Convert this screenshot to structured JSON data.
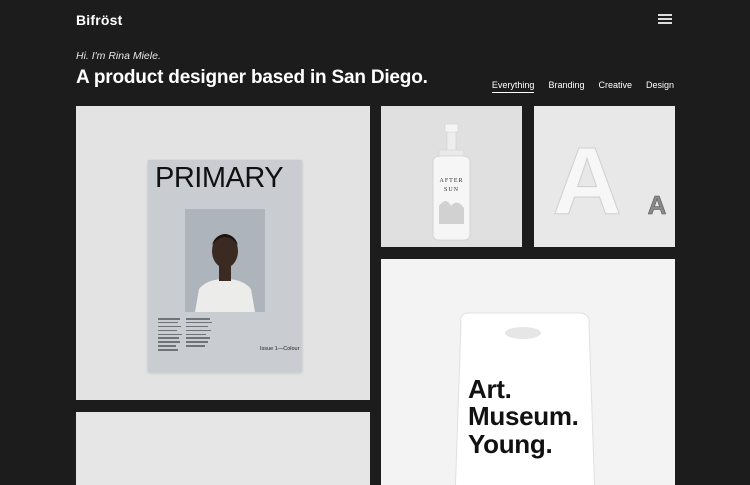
{
  "header": {
    "brand": "Bifröst",
    "menu_icon": "hamburger-icon"
  },
  "hero": {
    "intro": "Hi. I'm Rina Miele.",
    "headline": "A product designer based in San Diego."
  },
  "filters": [
    {
      "label": "Everything",
      "active": true
    },
    {
      "label": "Branding",
      "active": false
    },
    {
      "label": "Creative",
      "active": false
    },
    {
      "label": "Design",
      "active": false
    }
  ],
  "projects": {
    "magazine": {
      "title": "PRIMARY",
      "issue": "Issue 1—Colour"
    },
    "bottle": {
      "label_line1": "AFTER",
      "label_line2": "SUN"
    },
    "letter": {
      "big": "A",
      "small": "A"
    },
    "bag": {
      "lines": [
        "Art.",
        "Museum.",
        "Young."
      ]
    }
  },
  "colors": {
    "background": "#1c1c1c",
    "text": "#ffffff"
  }
}
